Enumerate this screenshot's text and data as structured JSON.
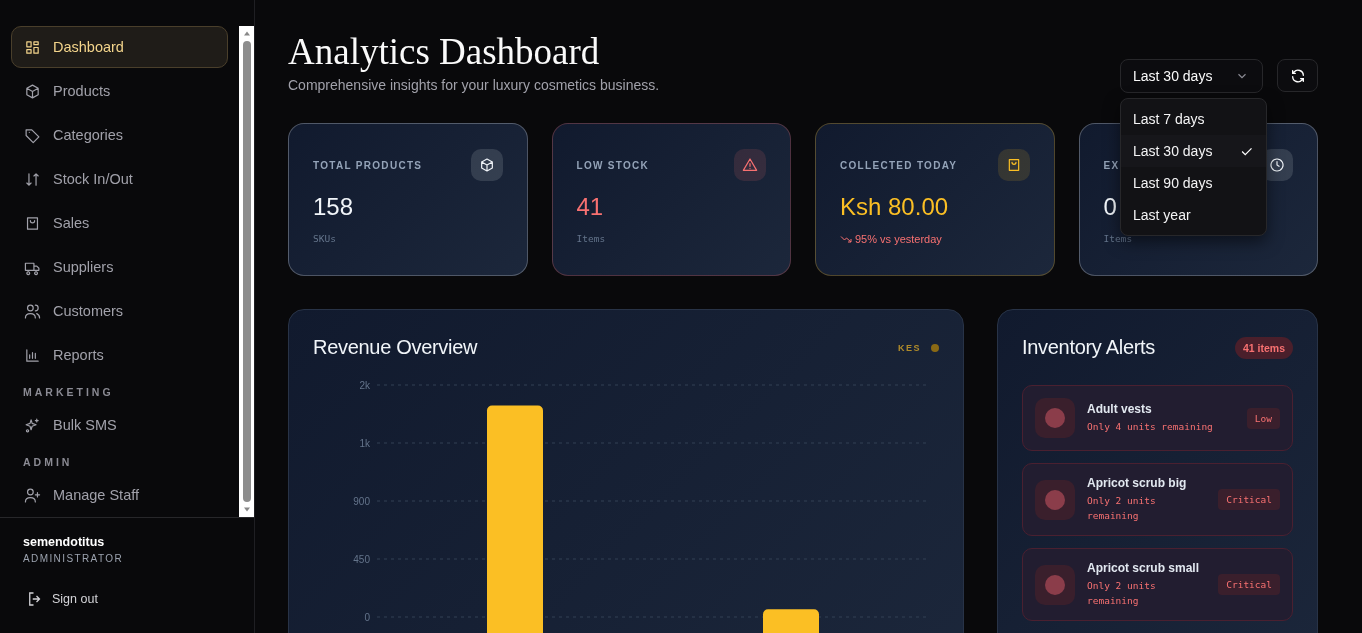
{
  "sidebar": {
    "nav": [
      {
        "kind": "item",
        "label": "Dashboard",
        "selected": true
      },
      {
        "kind": "item",
        "label": "Products",
        "selected": false
      },
      {
        "kind": "item",
        "label": "Categories",
        "selected": false
      },
      {
        "kind": "item",
        "label": "Stock In/Out",
        "selected": false
      },
      {
        "kind": "item",
        "label": "Sales",
        "selected": false
      },
      {
        "kind": "item",
        "label": "Suppliers",
        "selected": false
      },
      {
        "kind": "item",
        "label": "Customers",
        "selected": false
      },
      {
        "kind": "item",
        "label": "Reports",
        "selected": false
      },
      {
        "kind": "heading",
        "label": "MARKETING"
      },
      {
        "kind": "item",
        "label": "Bulk SMS",
        "selected": false
      },
      {
        "kind": "heading",
        "label": "ADMIN"
      },
      {
        "kind": "item",
        "label": "Manage Staff",
        "selected": false
      }
    ],
    "user": {
      "name": "semendotitus",
      "role": "ADMINISTRATOR"
    },
    "sign_out": "Sign out"
  },
  "header": {
    "title": "Analytics Dashboard",
    "subtitle": "Comprehensive insights for your luxury cosmetics business."
  },
  "range": {
    "value": "Last 30 days",
    "options": [
      {
        "label": "Last 7 days",
        "selected": false
      },
      {
        "label": "Last 30 days",
        "selected": true
      },
      {
        "label": "Last 90 days",
        "selected": false
      },
      {
        "label": "Last year",
        "selected": false
      }
    ]
  },
  "stats": [
    {
      "label": "TOTAL PRODUCTS",
      "value": "158",
      "sub": "SKUs",
      "color": "#f1f5f9"
    },
    {
      "label": "LOW STOCK",
      "value": "41",
      "sub": "Items",
      "color": "#f87171"
    },
    {
      "label": "COLLECTED TODAY",
      "value": "Ksh 80.00",
      "trend": {
        "text": "95% vs yesterday"
      },
      "color": "#fbbf24"
    },
    {
      "label": "EX",
      "value": "0",
      "sub": "Items",
      "color": "#f1f5f9"
    }
  ],
  "revenue": {
    "title": "Revenue Overview",
    "chart_data": {
      "type": "bar",
      "grid": true,
      "ylim": [
        0,
        1800
      ],
      "yticks": [
        0,
        450,
        900,
        {
          "value": 1350,
          "label": "1k"
        },
        {
          "value": 1800,
          "label": "2k"
        }
      ],
      "series": [
        {
          "name": "KES",
          "color": "#fbbf24",
          "values": [
            1640,
            60
          ]
        }
      ]
    }
  },
  "alerts": {
    "title": "Inventory Alerts",
    "count": "41 items",
    "items": [
      {
        "name": "Adult vests",
        "detail": "Only 4 units remaining",
        "status": "Low"
      },
      {
        "name": "Apricot scrub big",
        "detail": "Only 2 units remaining",
        "status": "Critical"
      },
      {
        "name": "Apricot scrub small",
        "detail": "Only 2 units remaining",
        "status": "Critical"
      }
    ]
  }
}
